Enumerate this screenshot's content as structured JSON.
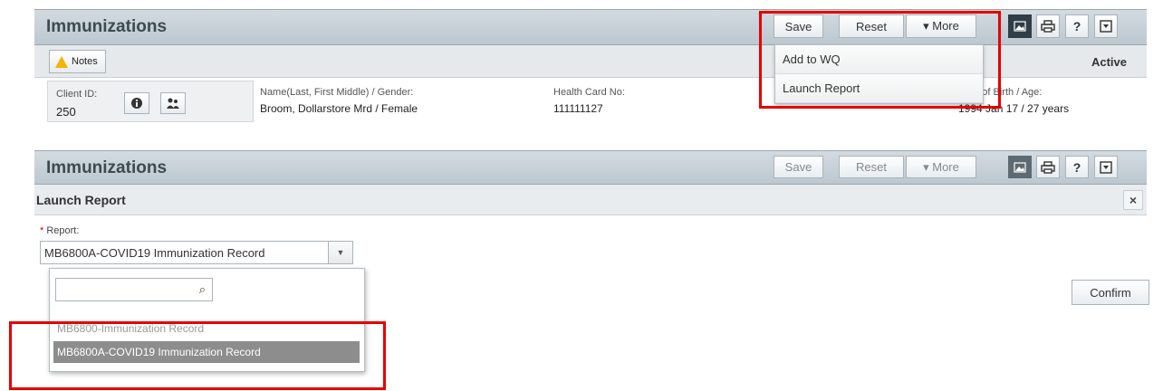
{
  "top": {
    "title": "Immunizations",
    "toolbar": {
      "save": "Save",
      "reset": "Reset",
      "more": "▾ More"
    },
    "icons": [
      "image-icon",
      "print-icon",
      "help-icon",
      "collapse-icon"
    ],
    "help_glyph": "?",
    "notes_label": "Notes",
    "status": "Active",
    "more_menu": [
      "Add to WQ",
      "Launch Report"
    ],
    "client": {
      "id_label": "Client ID:",
      "id_value": "250",
      "name_label": "Name(Last, First Middle) / Gender:",
      "name_value": "Broom, Dollarstore Mrd / Female",
      "hcn_label": "Health Card No:",
      "hcn_value": "111111127",
      "dob_label": "Date of Birth / Age:",
      "dob_value": "1994 Jan 17 / 27 years"
    }
  },
  "bottom": {
    "title": "Immunizations",
    "toolbar": {
      "save": "Save",
      "reset": "Reset",
      "more": "▾ More"
    },
    "help_glyph": "?",
    "dialog_title": "Launch Report",
    "close": "×",
    "report_label": "Report:",
    "required_mark": "*",
    "selected_report": "MB6800A-COVID19 Immunization Record",
    "search_placeholder": "",
    "options": [
      "MB6800-Immunization Record",
      "MB6800A-COVID19 Immunization Record"
    ],
    "confirm": "Confirm"
  },
  "colors": {
    "highlight": "#e60000",
    "header": "#c6d0d7",
    "selected_option": "#8d8d8d"
  }
}
